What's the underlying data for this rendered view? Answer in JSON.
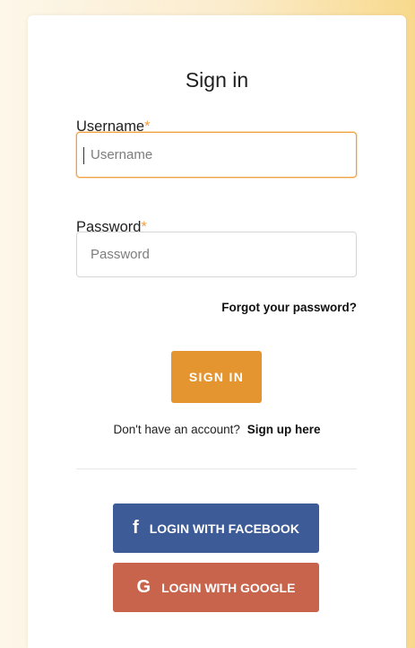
{
  "title": "Sign in",
  "username": {
    "label": "Username",
    "required_mark": "*",
    "placeholder": "Username",
    "value": ""
  },
  "password": {
    "label": "Password",
    "required_mark": "*",
    "placeholder": "Password",
    "value": ""
  },
  "forgot_link": "Forgot your password?",
  "signin_button": "SIGN IN",
  "signup": {
    "prompt": "Don't have an account?",
    "link": "Sign up here"
  },
  "social": {
    "facebook": {
      "icon": "facebook-icon",
      "glyph": "f",
      "label": "LOGIN WITH FACEBOOK"
    },
    "google": {
      "icon": "google-icon",
      "glyph": "G",
      "label": "LOGIN WITH GOOGLE"
    }
  },
  "colors": {
    "accent": "#e59530",
    "required": "#f0a040",
    "facebook": "#3d5b96",
    "google": "#c8634c"
  }
}
